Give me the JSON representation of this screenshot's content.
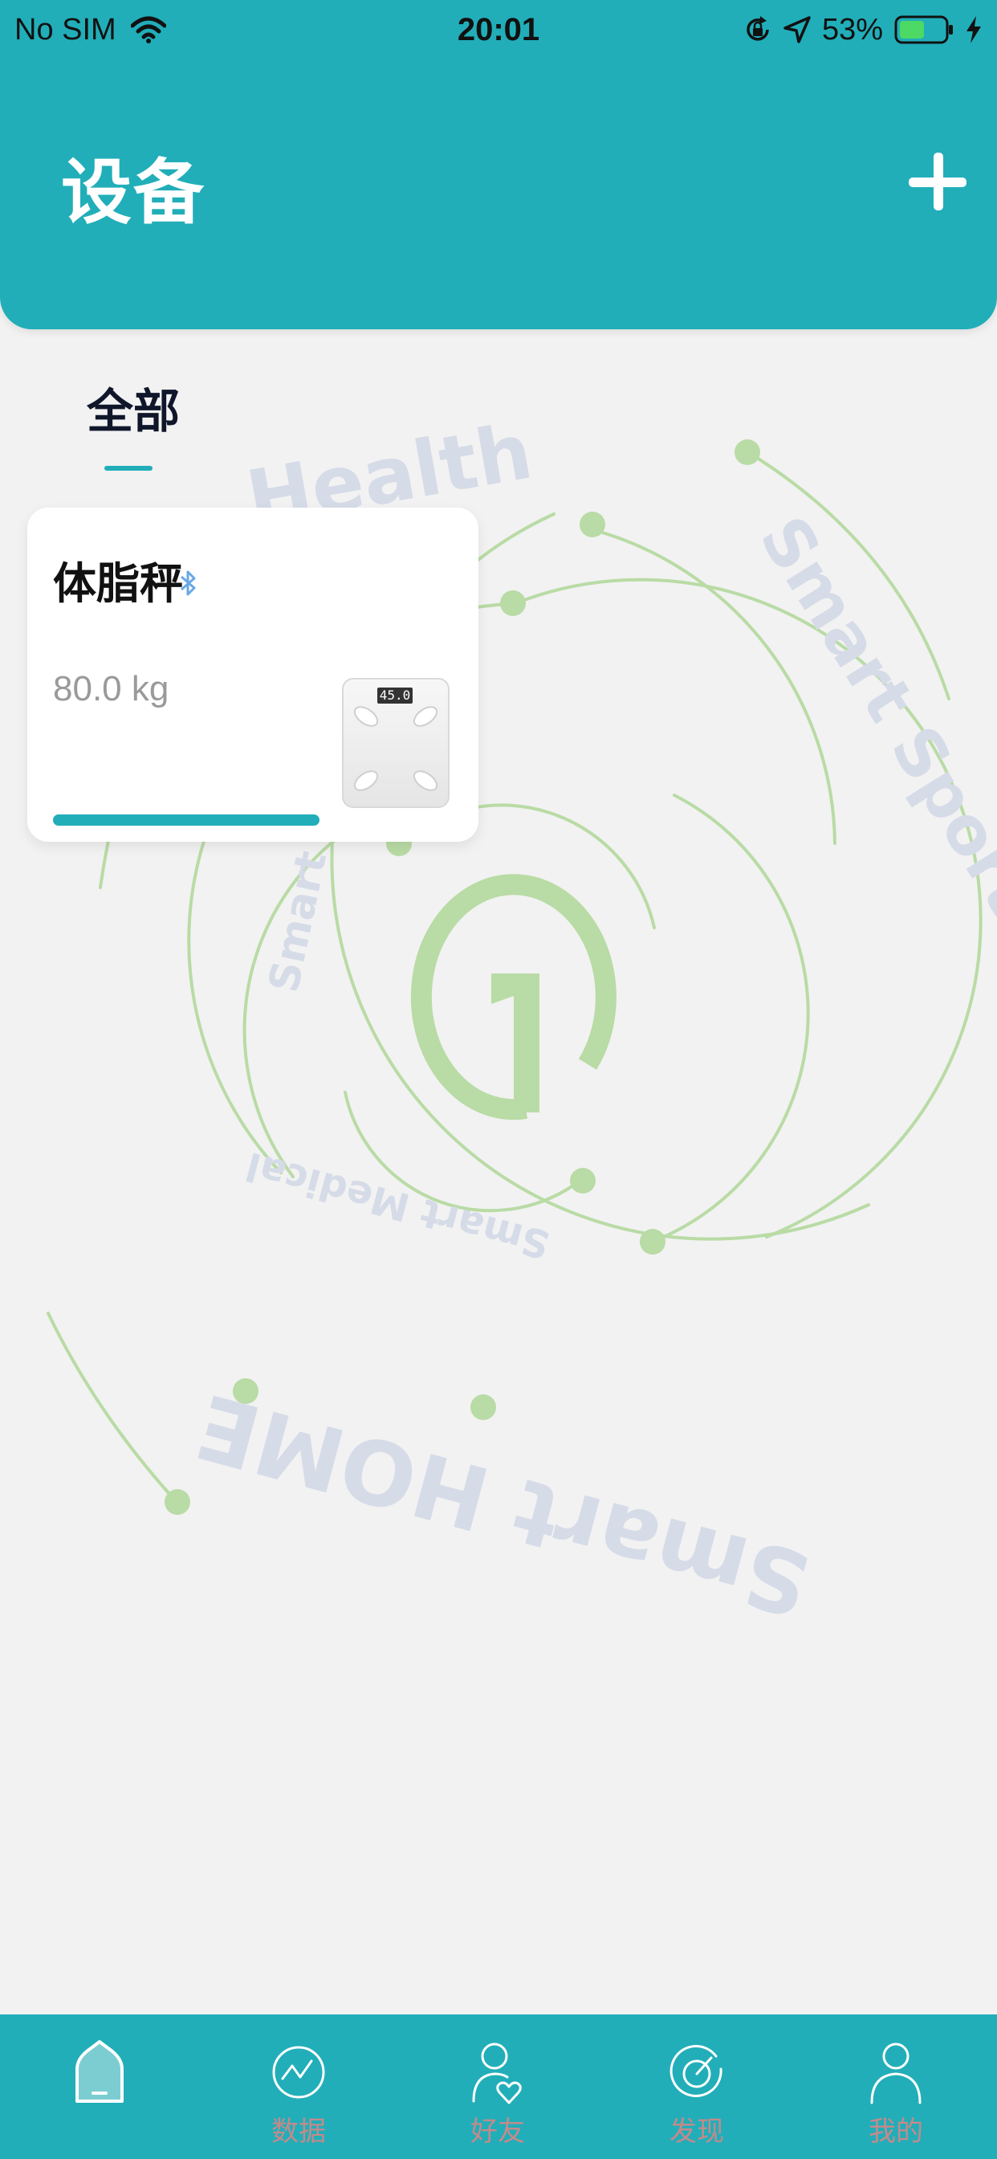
{
  "status_bar": {
    "carrier": "No SIM",
    "time": "20:01",
    "battery_percent": "53%",
    "battery_level": 0.53,
    "icons": [
      "wifi-icon",
      "rotation-lock-icon",
      "location-arrow-icon",
      "battery-icon",
      "charging-bolt-icon"
    ]
  },
  "header": {
    "title": "设备",
    "add_icon": "plus-icon"
  },
  "tabs": {
    "all_label": "全部"
  },
  "background_art": {
    "texts": [
      "Health",
      "Smart Sports",
      "Smart Medical",
      "Smart HOME",
      "Smart T"
    ],
    "logo_digit": "1"
  },
  "devices": [
    {
      "name": "体脂秤",
      "weight": "80.0 kg",
      "scale_display": "45.0",
      "connection_icon": "bluetooth-icon",
      "progress": 1.0
    }
  ],
  "bottom_nav": {
    "items": [
      {
        "label": "",
        "icon": "home-icon",
        "active": true
      },
      {
        "label": "数据",
        "icon": "chart-circle-icon",
        "active": false
      },
      {
        "label": "好友",
        "icon": "friend-heart-icon",
        "active": false
      },
      {
        "label": "发现",
        "icon": "discover-compass-icon",
        "active": false
      },
      {
        "label": "我的",
        "icon": "profile-icon",
        "active": false
      }
    ]
  },
  "colors": {
    "primary": "#21aeb9",
    "background": "#f2f2f2",
    "art_green": "#b9dba5",
    "art_text": "#d6dbe8",
    "tab_label": "#c48a8a"
  }
}
